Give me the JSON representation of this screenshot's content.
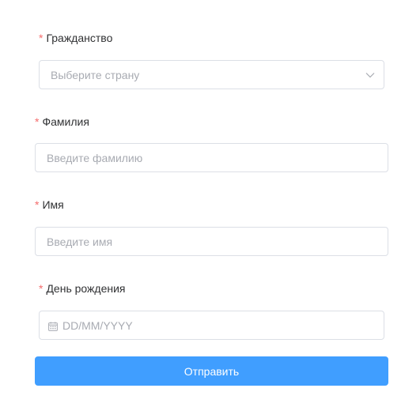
{
  "form": {
    "required_mark": "*",
    "citizenship": {
      "label": "Гражданство",
      "placeholder": "Выберите страну",
      "icon": "chevron-down-icon"
    },
    "last_name": {
      "label": "Фамилия",
      "placeholder": "Введите фамилию"
    },
    "first_name": {
      "label": "Имя",
      "placeholder": "Введите имя"
    },
    "birth_date": {
      "label": "День рождения",
      "placeholder": "DD/MM/YYYY",
      "icon": "calendar-icon"
    },
    "submit_label": "Отправить"
  },
  "colors": {
    "required": "#f56c6c",
    "primary": "#409eff",
    "border": "#dcdfe6",
    "placeholder": "#a8abb2"
  }
}
